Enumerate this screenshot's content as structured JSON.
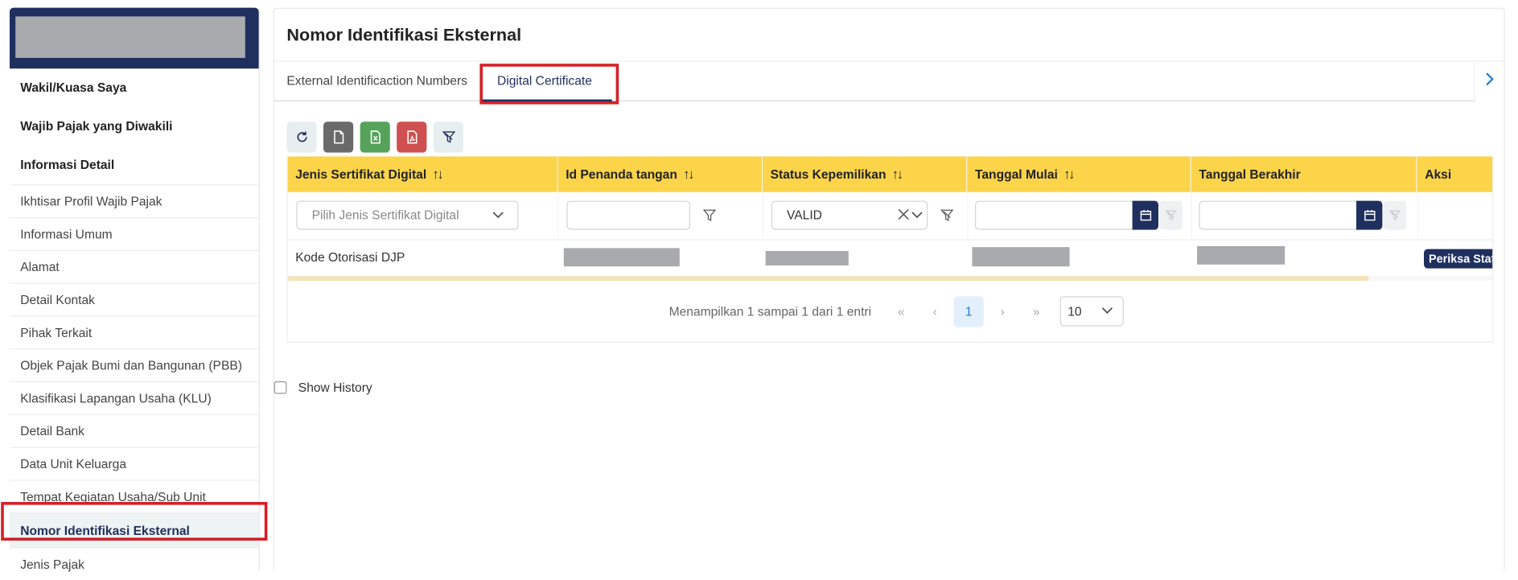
{
  "sidebar": {
    "headers": [
      "Wakil/Kuasa Saya",
      "Wajib Pajak yang Diwakili",
      "Informasi Detail"
    ],
    "items": [
      {
        "label": "Ikhtisar Profil Wajib Pajak"
      },
      {
        "label": "Informasi Umum"
      },
      {
        "label": "Alamat"
      },
      {
        "label": "Detail Kontak"
      },
      {
        "label": "Pihak Terkait"
      },
      {
        "label": "Objek Pajak Bumi dan Bangunan (PBB)"
      },
      {
        "label": "Klasifikasi Lapangan Usaha (KLU)"
      },
      {
        "label": "Detail Bank"
      },
      {
        "label": "Data Unit Keluarga"
      },
      {
        "label": "Tempat Kegiatan Usaha/Sub Unit"
      },
      {
        "label": "Nomor Identifikasi Eksternal",
        "active": true
      },
      {
        "label": "Jenis Pajak"
      }
    ]
  },
  "main": {
    "title": "Nomor Identifikasi Eksternal",
    "tabs": [
      {
        "label": "External Identificaction Numbers"
      },
      {
        "label": "Digital Certificate",
        "active": true
      }
    ]
  },
  "toolbar": {
    "buttons": [
      "refresh-icon",
      "document-icon",
      "excel-icon",
      "pdf-icon",
      "filter-clear-icon"
    ]
  },
  "table": {
    "columns": [
      {
        "label": "Jenis Sertifikat Digital",
        "sortable": true
      },
      {
        "label": "Id Penanda tangan",
        "sortable": true
      },
      {
        "label": "Status Kepemilikan",
        "sortable": true
      },
      {
        "label": "Tanggal Mulai",
        "sortable": true
      },
      {
        "label": "Tanggal Berakhir",
        "sortable": false
      },
      {
        "label": "Aksi",
        "sortable": false
      }
    ],
    "filters": {
      "jenis_placeholder": "Pilih Jenis Sertifikat Digital",
      "status_value": "VALID"
    },
    "rows": [
      {
        "jenis": "Kode Otorisasi DJP",
        "action": "Periksa Status"
      }
    ],
    "sort_glyph": "↑↓"
  },
  "pagination": {
    "info": "Menampilkan 1 sampai 1 dari 1 entri",
    "first": "«",
    "prev": "‹",
    "current": "1",
    "next": "›",
    "last": "»",
    "rows_per_page": "10"
  },
  "history": {
    "label": "Show History"
  },
  "colors": {
    "navy": "#1f2f5e",
    "header_yellow": "#fbd44a",
    "highlight_red": "#d61f26"
  }
}
